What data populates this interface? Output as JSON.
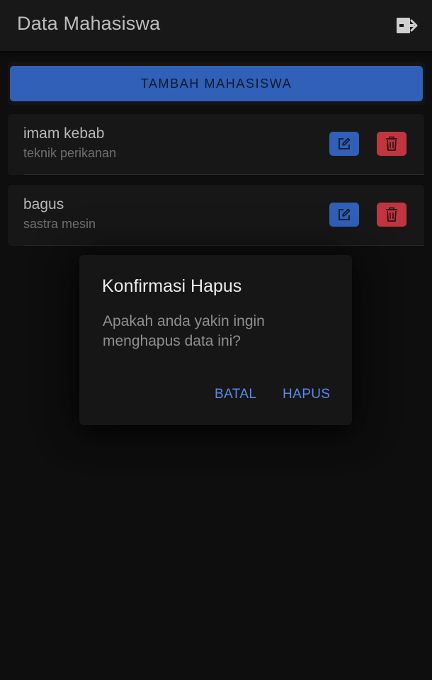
{
  "appbar": {
    "title": "Data Mahasiswa",
    "logout_icon": "logout-icon"
  },
  "add_button": {
    "label": "TAMBAH MAHASISWA"
  },
  "students": [
    {
      "name": "imam kebab",
      "major": "teknik perikanan"
    },
    {
      "name": "bagus",
      "major": "sastra mesin"
    }
  ],
  "row_icons": {
    "edit": "edit-icon",
    "delete": "trash-icon"
  },
  "dialog": {
    "title": "Konfirmasi Hapus",
    "message": "Apakah anda yakin ingin menghapus data ini?",
    "cancel_label": "BATAL",
    "confirm_label": "HAPUS"
  },
  "colors": {
    "background": "#0e0e0e",
    "appbar": "#181818",
    "primary": "#3060b7",
    "danger": "#c0353f",
    "dialog_action": "#5b8ae6"
  }
}
